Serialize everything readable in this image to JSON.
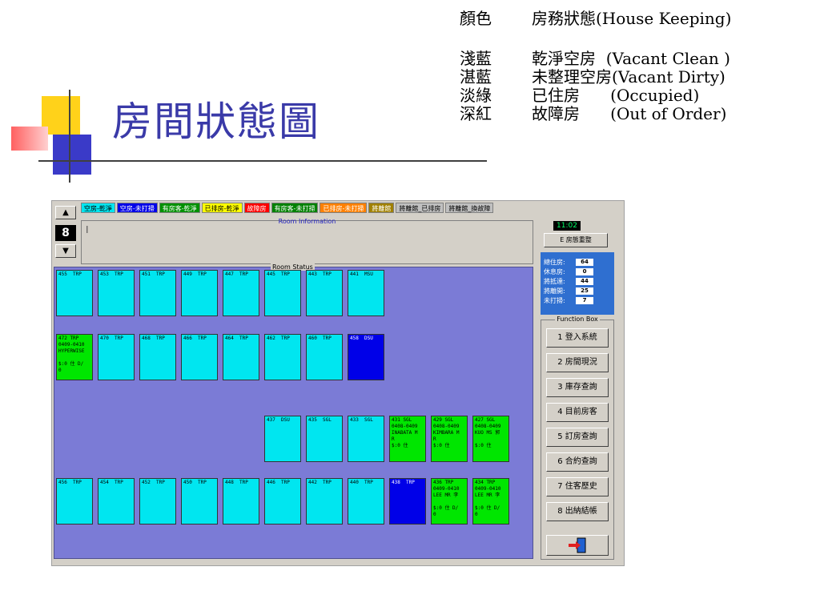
{
  "slide": {
    "title": "房間狀態圖",
    "legend_header": {
      "col1": "顏色",
      "col2": "房務狀態(House Keeping)"
    },
    "legend_rows": [
      {
        "color_name": "淺藍",
        "status": "乾淨空房  (Vacant Clean )"
      },
      {
        "color_name": "湛藍",
        "status": "未整理空房(Vacant Dirty)"
      },
      {
        "color_name": "淡綠",
        "status": "已住房      (Occupied)"
      },
      {
        "color_name": "深紅",
        "status": "故障房      (Out of Order)"
      }
    ]
  },
  "app": {
    "legend_chips": [
      {
        "label": "空房-乾淨",
        "bg": "#00e6f0",
        "fg": "#000000"
      },
      {
        "label": "空房-未打掃",
        "bg": "#0000e8",
        "fg": "#ffffff"
      },
      {
        "label": "有房客-乾淨",
        "bg": "#009000",
        "fg": "#ffffff"
      },
      {
        "label": "已排房-乾淨",
        "bg": "#ffff00",
        "fg": "#000000"
      },
      {
        "label": "故障房",
        "bg": "#ff0000",
        "fg": "#ffffff"
      },
      {
        "label": "有房客-未打掃",
        "bg": "#008000",
        "fg": "#ffffff"
      },
      {
        "label": "已排房-未打掃",
        "bg": "#ff8000",
        "fg": "#ffffff"
      },
      {
        "label": "將離館",
        "bg": "#a08000",
        "fg": "#ffffff"
      },
      {
        "label": "將離館_已排房",
        "bg": "#c0c0c0",
        "fg": "#000000"
      },
      {
        "label": "將離館_換故障",
        "bg": "#c0c0c0",
        "fg": "#000000"
      }
    ],
    "floor": "8",
    "info_panel_label": "Room Information",
    "info_cursor": "I",
    "status_panel_label": "Room Status",
    "rooms": [
      {
        "text": "455  TRP",
        "state": "vc"
      },
      {
        "text": "453  TRP",
        "state": "vc"
      },
      {
        "text": "451  TRP",
        "state": "vc"
      },
      {
        "text": "449  TRP",
        "state": "vc"
      },
      {
        "text": "447  TRP",
        "state": "vc"
      },
      {
        "text": "445  TRP",
        "state": "vc"
      },
      {
        "text": "443  TRP",
        "state": "vc"
      },
      {
        "text": "441  MSU",
        "state": "vc"
      },
      {
        "text": "472 TRP\n0409-0410\nHYPERWISE\n\n$:0 住 D/\n0",
        "state": "oc"
      },
      {
        "text": "470  TRP",
        "state": "vc"
      },
      {
        "text": "468  TRP",
        "state": "vc"
      },
      {
        "text": "466  TRP",
        "state": "vc"
      },
      {
        "text": "464  TRP",
        "state": "vc"
      },
      {
        "text": "462  TRP",
        "state": "vc"
      },
      {
        "text": "460  TRP",
        "state": "vc"
      },
      {
        "text": "458  DSU",
        "state": "vd"
      },
      {
        "text": "437  DSU",
        "state": "vc"
      },
      {
        "text": "435  SGL",
        "state": "vc"
      },
      {
        "text": "433  SGL",
        "state": "vc"
      },
      {
        "text": "431 SGL\n0408-0409\nINABATA M\nR\n$:0 住",
        "state": "oc"
      },
      {
        "text": "429 SGL\n0408-0409\nKIMBARA M\nR\n$:0 住",
        "state": "oc"
      },
      {
        "text": "427 SGL\n0408-0409\nKUO MS 郭\n\n$:0 住",
        "state": "oc"
      },
      {
        "text": "456  TRP",
        "state": "vc"
      },
      {
        "text": "454  TRP",
        "state": "vc"
      },
      {
        "text": "452  TRP",
        "state": "vc"
      },
      {
        "text": "450  TRP",
        "state": "vc"
      },
      {
        "text": "448  TRP",
        "state": "vc"
      },
      {
        "text": "446  TRP",
        "state": "vc"
      },
      {
        "text": "442  TRP",
        "state": "vc"
      },
      {
        "text": "440  TRP",
        "state": "vc"
      },
      {
        "text": "438  TRP",
        "state": "vd"
      },
      {
        "text": "436 TRP\n0409-0410\nLEE MR 李\n\n$:0 住 D/\n0",
        "state": "oc"
      },
      {
        "text": "434 TRP\n0409-0410\nLEE MR 李\n\n$:0 住 D/\n0",
        "state": "oc"
      }
    ],
    "clock": "11:02",
    "reassign_button": "E 房態重整",
    "stats": [
      {
        "label": "總住房:",
        "value": "64"
      },
      {
        "label": "休息房:",
        "value": "0"
      },
      {
        "label": "將抵達:",
        "value": "44"
      },
      {
        "label": "將離開:",
        "value": "25"
      },
      {
        "label": "未打掃:",
        "value": "7"
      }
    ],
    "function_box_label": "Function Box",
    "functions": [
      "1 登入系統",
      "2 房間現況",
      "3 庫存查詢",
      "4 目前房客",
      "5 訂房查詢",
      "6 合約查詢",
      "7 住客歷史",
      "8 出納結帳"
    ],
    "exit_icon": "exit-door-icon"
  }
}
